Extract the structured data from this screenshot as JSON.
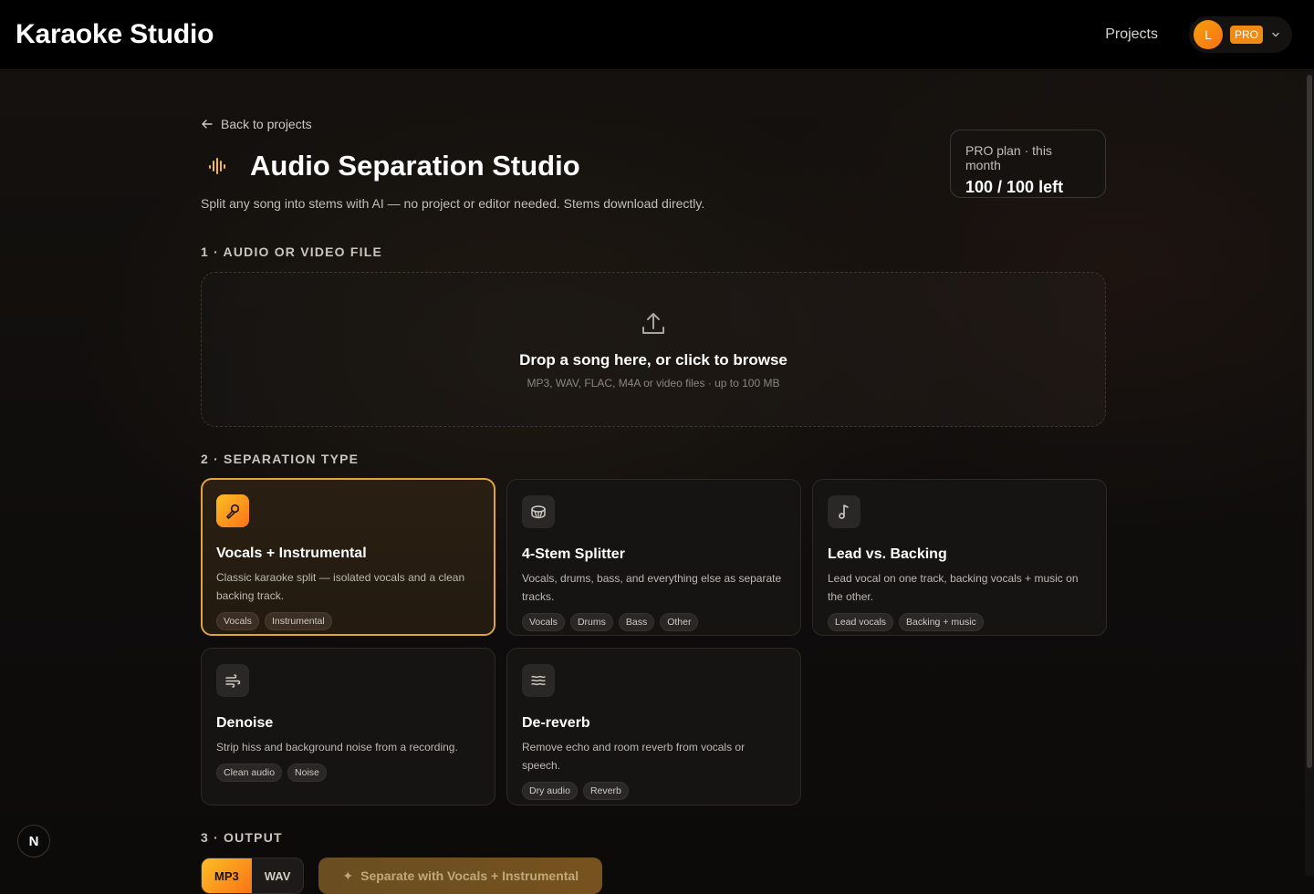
{
  "app": {
    "title": "Karaoke Studio"
  },
  "header": {
    "nav_projects": "Projects",
    "user_initial": "L",
    "plan_badge": "PRO"
  },
  "page": {
    "back_label": "Back to projects",
    "title": "Audio Separation Studio",
    "subtitle": "Split any song into stems with AI — no project or editor needed. Stems download directly.",
    "quota_label": "PRO plan · this month",
    "quota_value": "100 / 100 left"
  },
  "sections": {
    "file": "1 · AUDIO OR VIDEO FILE",
    "type": "2 · SEPARATION TYPE",
    "output": "3 · OUTPUT"
  },
  "dropzone": {
    "title": "Drop a song here, or click to browse",
    "subtitle": "MP3, WAV, FLAC, M4A or video files · up to 100 MB"
  },
  "separation_types": [
    {
      "title": "Vocals + Instrumental",
      "desc": "Classic karaoke split — isolated vocals and a clean backing track.",
      "tags": [
        "Vocals",
        "Instrumental"
      ],
      "icon": "microphone-icon",
      "selected": true
    },
    {
      "title": "4-Stem Splitter",
      "desc": "Vocals, drums, bass, and everything else as separate tracks.",
      "tags": [
        "Vocals",
        "Drums",
        "Bass",
        "Other"
      ],
      "icon": "drum-icon",
      "selected": false
    },
    {
      "title": "Lead vs. Backing",
      "desc": "Lead vocal on one track, backing vocals + music on the other.",
      "tags": [
        "Lead vocals",
        "Backing + music"
      ],
      "icon": "music-note-icon",
      "selected": false
    },
    {
      "title": "Denoise",
      "desc": "Strip hiss and background noise from a recording.",
      "tags": [
        "Clean audio",
        "Noise"
      ],
      "icon": "wind-icon",
      "selected": false
    },
    {
      "title": "De-reverb",
      "desc": "Remove echo and room reverb from vocals or speech.",
      "tags": [
        "Dry audio",
        "Reverb"
      ],
      "icon": "waves-icon",
      "selected": false
    }
  ],
  "output": {
    "formats": [
      "MP3",
      "WAV"
    ],
    "selected_format": "MP3",
    "generate_label": "Separate with Vocals + Instrumental"
  },
  "fab_label": "N",
  "colors": {
    "accent": "#f59e0b",
    "accent2": "#f97316",
    "background": "#0c0b0a"
  }
}
